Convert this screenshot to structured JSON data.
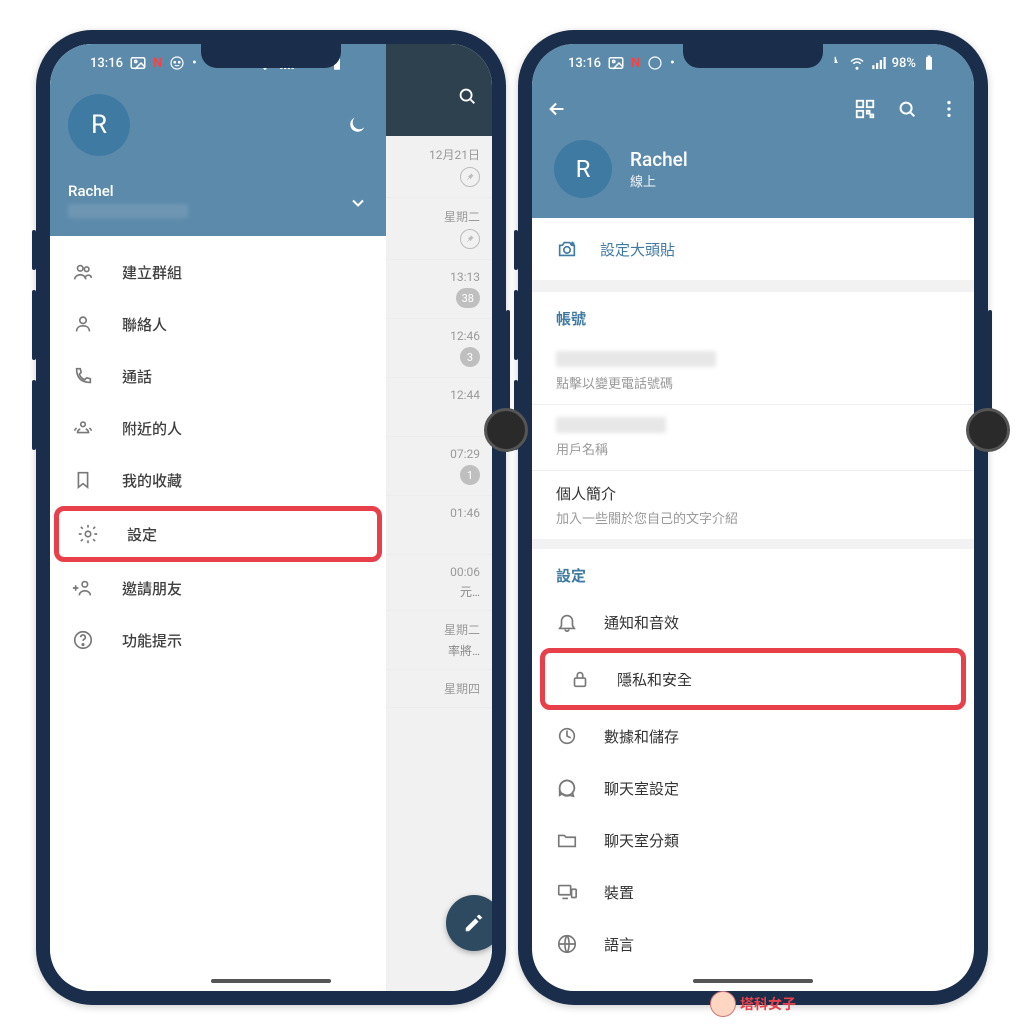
{
  "status": {
    "time": "13:16",
    "battery": "98%"
  },
  "phone1": {
    "drawer": {
      "avatar_letter": "R",
      "name": "Rachel",
      "items": [
        {
          "label": "建立群組"
        },
        {
          "label": "聯絡人"
        },
        {
          "label": "通話"
        },
        {
          "label": "附近的人"
        },
        {
          "label": "我的收藏"
        },
        {
          "label": "設定"
        },
        {
          "label": "邀請朋友"
        },
        {
          "label": "功能提示"
        }
      ]
    },
    "behind": [
      {
        "time": "12月21日",
        "badge": "pin"
      },
      {
        "time": "星期二",
        "badge": "pin"
      },
      {
        "time": "13:13",
        "badge": "38"
      },
      {
        "time": "12:46",
        "badge": "3"
      },
      {
        "time": "12:44",
        "badge": ""
      },
      {
        "time": "07:29",
        "badge": "1"
      },
      {
        "time": "01:46",
        "badge": ""
      },
      {
        "time": "00:06",
        "text": "元…"
      },
      {
        "time": "星期二",
        "text": "率將…"
      },
      {
        "time": "星期四",
        "badge": ""
      }
    ]
  },
  "phone2": {
    "profile": {
      "avatar_letter": "R",
      "name": "Rachel",
      "status": "線上"
    },
    "set_photo": "設定大頭貼",
    "account": {
      "title": "帳號",
      "phone_sub": "點擊以變更電話號碼",
      "username_sub": "用戶名稱",
      "bio_primary": "個人簡介",
      "bio_sub": "加入一些關於您自己的文字介紹"
    },
    "settings": {
      "title": "設定",
      "items": [
        {
          "label": "通知和音效"
        },
        {
          "label": "隱私和安全"
        },
        {
          "label": "數據和儲存"
        },
        {
          "label": "聊天室設定"
        },
        {
          "label": "聊天室分類"
        },
        {
          "label": "裝置"
        },
        {
          "label": "語言"
        }
      ]
    }
  },
  "watermark": "塔科女子"
}
